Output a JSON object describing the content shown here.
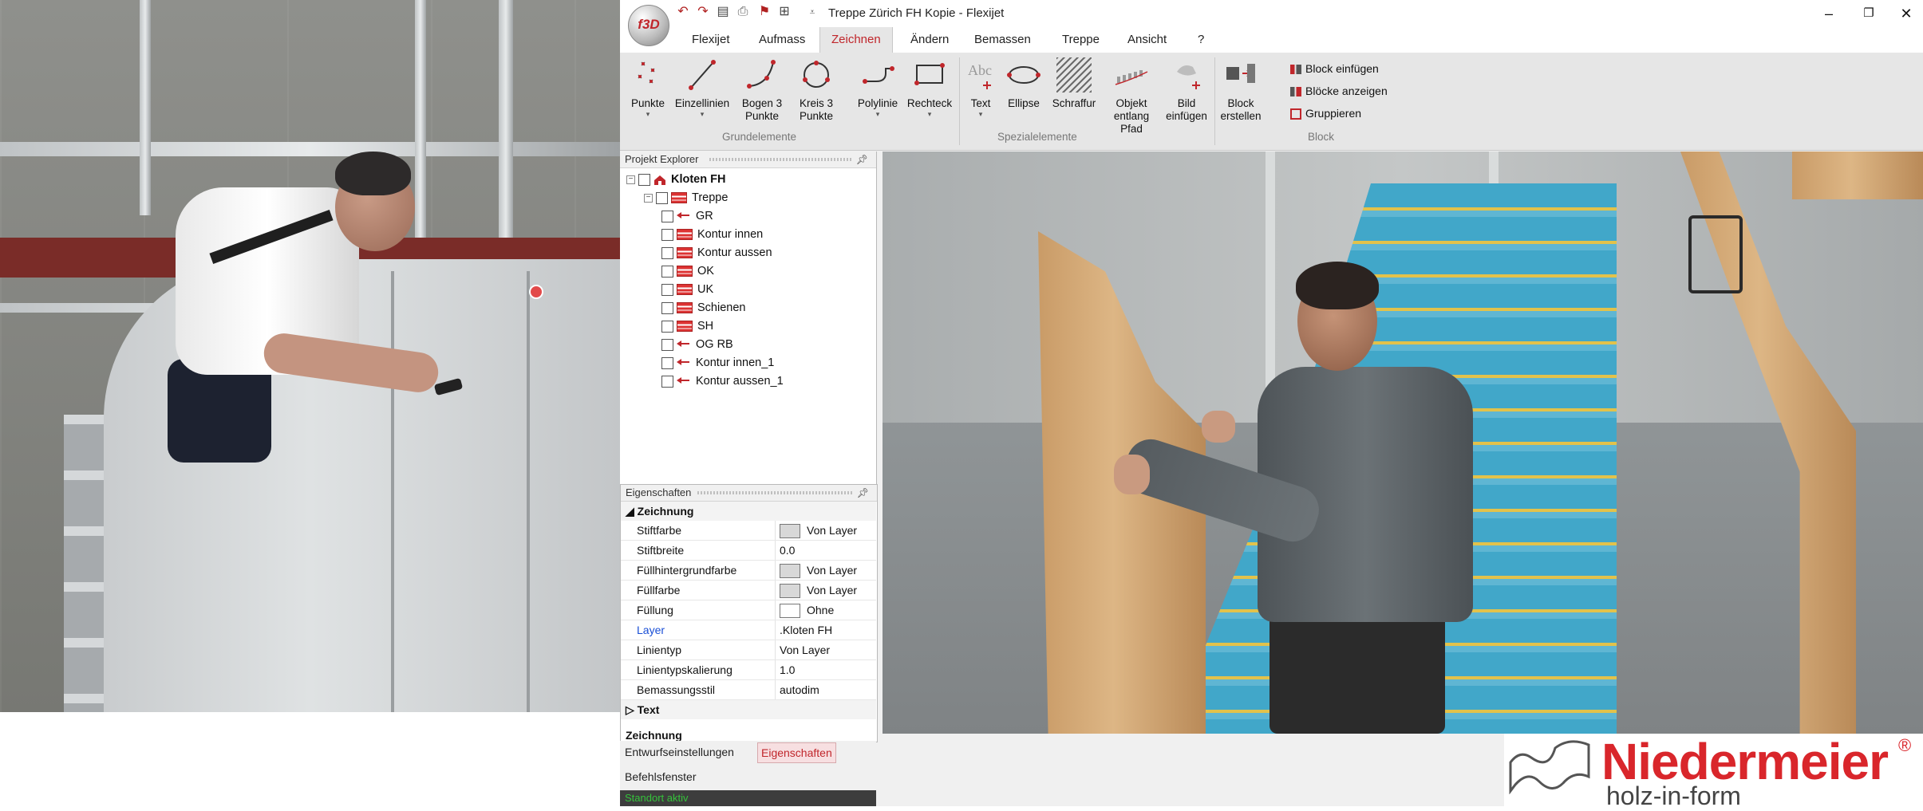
{
  "window": {
    "title": "Treppe Zürich FH Kopie -  Flexijet",
    "app_logo": "f3D"
  },
  "ribbon": {
    "tabs": [
      "Flexijet",
      "Aufmass",
      "Zeichnen",
      "Ändern",
      "Bemassen",
      "Treppe",
      "Ansicht",
      "?"
    ],
    "active_tab": "Zeichnen",
    "groups": {
      "grundelemente": {
        "label": "Grundelemente",
        "buttons": {
          "punkte": "Punkte",
          "einzellinien": "Einzellinien",
          "bogen3": "Bogen 3 Punkte",
          "kreis3": "Kreis 3 Punkte",
          "polylinie": "Polylinie",
          "rechteck": "Rechteck"
        }
      },
      "spezialelemente": {
        "label": "Spezialelemente",
        "buttons": {
          "text": "Text",
          "ellipse": "Ellipse",
          "schraffur": "Schraffur",
          "objekt_pfad": "Objekt entlang Pfad",
          "bild": "Bild einfügen"
        }
      },
      "block": {
        "label": "Block",
        "buttons": {
          "block_erstellen": "Block erstellen",
          "block_einfuegen": "Block einfügen",
          "bloecke_anzeigen": "Blöcke anzeigen",
          "gruppieren": "Gruppieren"
        }
      }
    }
  },
  "explorer": {
    "title": "Projekt Explorer",
    "root": "Kloten FH",
    "child": "Treppe",
    "layers": [
      {
        "label": "GR",
        "icon": "arrow"
      },
      {
        "label": "Kontur innen",
        "icon": "stack"
      },
      {
        "label": "Kontur aussen",
        "icon": "stack"
      },
      {
        "label": "OK",
        "icon": "stack"
      },
      {
        "label": "UK",
        "icon": "stack"
      },
      {
        "label": "Schienen",
        "icon": "stack"
      },
      {
        "label": "SH",
        "icon": "stack"
      },
      {
        "label": "OG RB",
        "icon": "arrow"
      },
      {
        "label": "Kontur innen_1",
        "icon": "arrow"
      },
      {
        "label": "Kontur aussen_1",
        "icon": "arrow"
      }
    ]
  },
  "properties": {
    "title": "Eigenschaften",
    "category": "Zeichnung",
    "rows": [
      {
        "name": "Stiftfarbe",
        "value": "Von Layer",
        "swatch": "#d8d8d8"
      },
      {
        "name": "Stiftbreite",
        "value": "0.0"
      },
      {
        "name": "Füllhintergrundfarbe",
        "value": "Von Layer",
        "swatch": "#d8d8d8"
      },
      {
        "name": "Füllfarbe",
        "value": "Von Layer",
        "swatch": "#d8d8d8"
      },
      {
        "name": "Füllung",
        "value": "Ohne",
        "swatch": "#ffffff"
      },
      {
        "name": "Layer",
        "value": ".Kloten FH",
        "highlight": true
      },
      {
        "name": "Linientyp",
        "value": "Von Layer"
      },
      {
        "name": "Linientypskalierung",
        "value": "1.0"
      },
      {
        "name": "Bemassungsstil",
        "value": "autodim"
      }
    ],
    "collapsed_category": "Text",
    "footer_label": "Zeichnung"
  },
  "bottom_tabs": {
    "entwurf": "Entwurfseinstellungen",
    "eigenschaften": "Eigenschaften"
  },
  "command_window": "Befehlsfenster",
  "status": "Standort aktiv",
  "brand": {
    "name": "Niedermeier",
    "tagline": "holz-in-form",
    "reg": "®"
  },
  "colors": {
    "accent": "#c0262b",
    "status_text": "#35c23b",
    "layer_highlight": "#1a4fd6"
  }
}
